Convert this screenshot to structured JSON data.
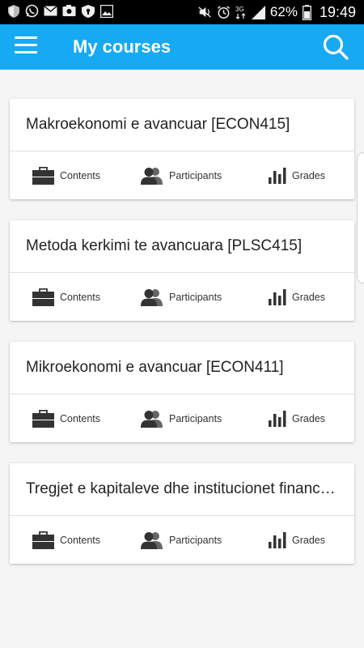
{
  "status_bar": {
    "left_icons": [
      "shield-icon",
      "whatsapp-icon",
      "mail-icon",
      "photo-icon",
      "vpn-icon",
      "image-icon"
    ],
    "right_icons": [
      "mute-icon",
      "alarm-icon",
      "network-3g-icon",
      "signal-icon"
    ],
    "network": "3G",
    "battery": "62%",
    "time": "19:49"
  },
  "app_bar": {
    "title": "My courses",
    "background": "#15aaf3"
  },
  "actions": {
    "contents": "Contents",
    "participants": "Participants",
    "grades": "Grades"
  },
  "courses": [
    {
      "title": "Makroekonomi e avancuar [ECON415]"
    },
    {
      "title": "Metoda kerkimi te avancuara [PLSC415]"
    },
    {
      "title": "Mikroekonomi e avancuar [ECON411]"
    },
    {
      "title": "Tregjet e kapitaleve dhe institucionet financiare"
    }
  ]
}
